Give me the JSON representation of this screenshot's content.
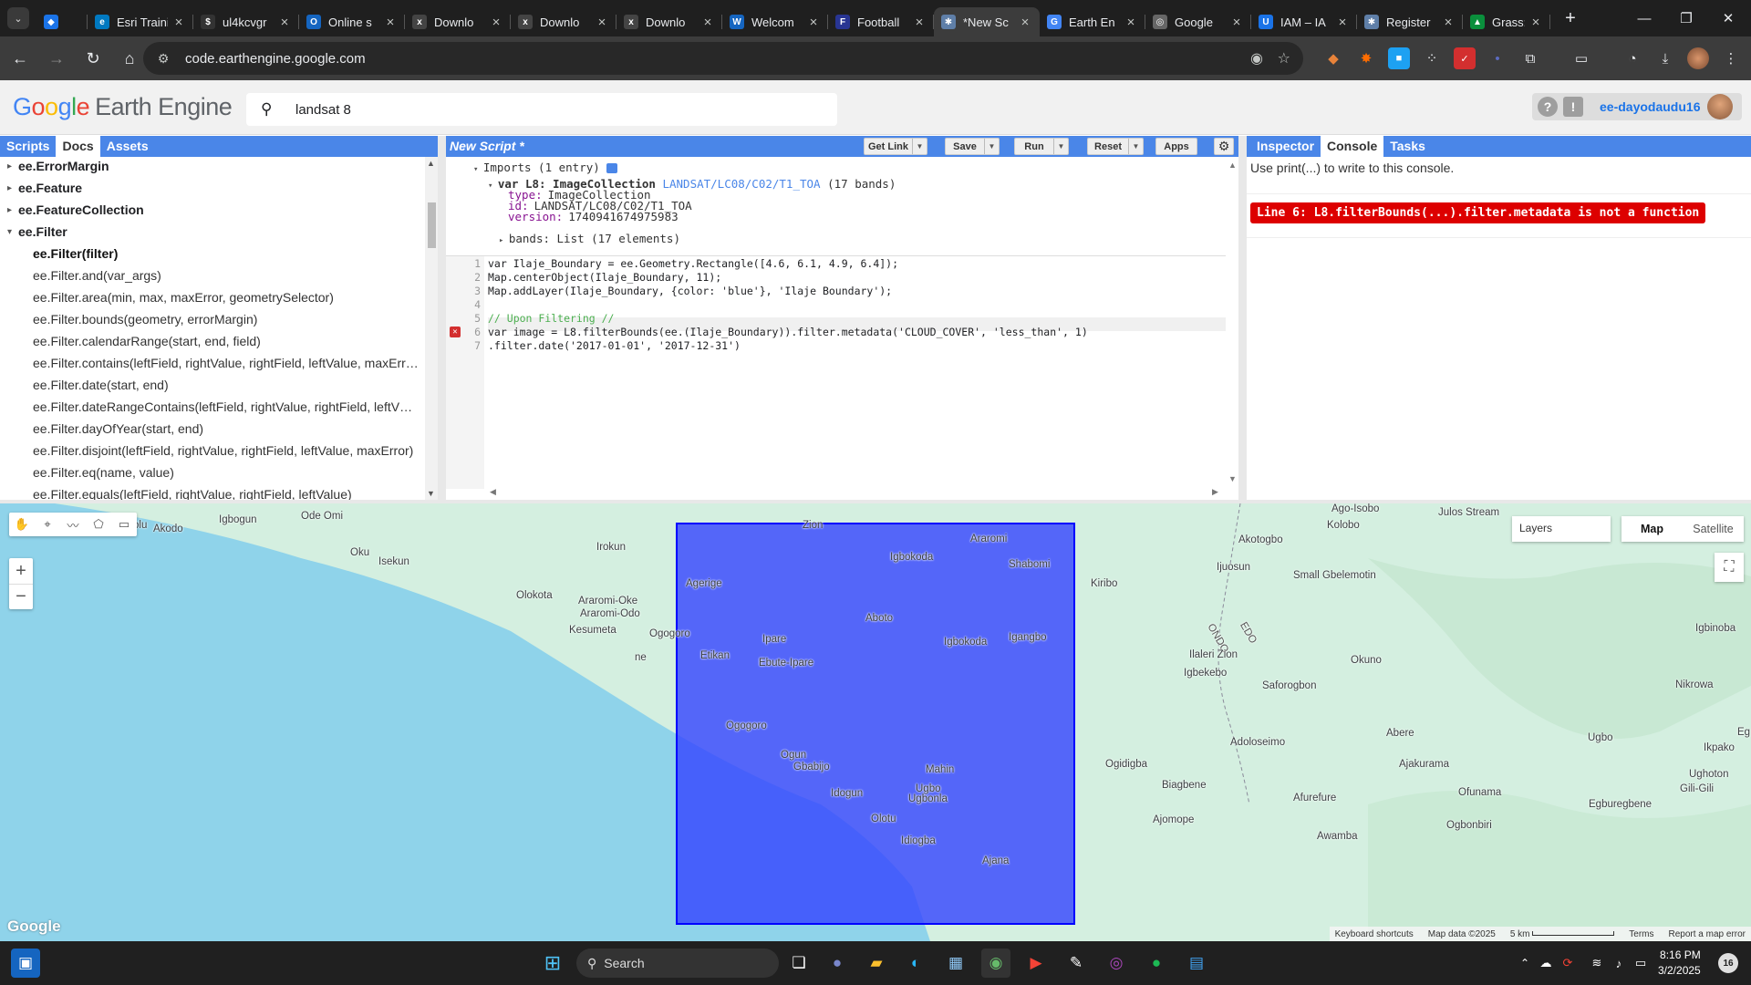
{
  "browser": {
    "tabs": [
      {
        "title": "",
        "fav_color": "#1a73e8",
        "fav": "◆"
      },
      {
        "title": "Esri Training",
        "fav_color": "#0079c1",
        "fav": "e"
      },
      {
        "title": "ul4kcvgr",
        "fav_color": "#333333",
        "fav": "$"
      },
      {
        "title": "Online s",
        "fav_color": "#1565c0",
        "fav": "O"
      },
      {
        "title": "Downlo",
        "fav_color": "#444444",
        "fav": "x"
      },
      {
        "title": "Downlo",
        "fav_color": "#444444",
        "fav": "x"
      },
      {
        "title": "Downlo",
        "fav_color": "#444444",
        "fav": "x"
      },
      {
        "title": "Welcom",
        "fav_color": "#1565c0",
        "fav": "W"
      },
      {
        "title": "Football",
        "fav_color": "#283593",
        "fav": "F"
      },
      {
        "title": "*New Sc",
        "fav_color": "#5f7fa8",
        "fav": "✱",
        "active": true
      },
      {
        "title": "Earth En",
        "fav_color": "#4285f4",
        "fav": "G"
      },
      {
        "title": "Google",
        "fav_color": "#666666",
        "fav": "◎"
      },
      {
        "title": "IAM – IA",
        "fav_color": "#1a73e8",
        "fav": "U"
      },
      {
        "title": "Register",
        "fav_color": "#5f7fa8",
        "fav": "✱"
      },
      {
        "title": "Grass: Tr",
        "fav_color": "#0a8f3c",
        "fav": "▲"
      }
    ],
    "url": "code.earthengine.google.com"
  },
  "ee": {
    "logo": {
      "g1": "G",
      "g2": "o",
      "g3": "o",
      "g4": "g",
      "g5": "l",
      "g6": "e",
      "product": "Earth Engine"
    },
    "search_value": "landsat 8",
    "username": "ee-dayodaudu16",
    "help": "?",
    "feedback": "!"
  },
  "left_tabs": [
    "Scripts",
    "Docs",
    "Assets"
  ],
  "docs": [
    {
      "text": "ee.ErrorMargin",
      "kind": "top",
      "arrow": "▸"
    },
    {
      "text": "ee.Feature",
      "kind": "top",
      "arrow": "▸"
    },
    {
      "text": "ee.FeatureCollection",
      "kind": "top",
      "arrow": "▸"
    },
    {
      "text": "ee.Filter",
      "kind": "top",
      "arrow": "▾"
    },
    {
      "text": "ee.Filter(filter)",
      "kind": "sub",
      "bold": true
    },
    {
      "text": "ee.Filter.and(var_args)",
      "kind": "sub"
    },
    {
      "text": "ee.Filter.area(min, max, maxError, geometrySelector)",
      "kind": "sub"
    },
    {
      "text": "ee.Filter.bounds(geometry, errorMargin)",
      "kind": "sub"
    },
    {
      "text": "ee.Filter.calendarRange(start, end, field)",
      "kind": "sub"
    },
    {
      "text": "ee.Filter.contains(leftField, rightValue, rightField, leftValue, maxErr…",
      "kind": "sub"
    },
    {
      "text": "ee.Filter.date(start, end)",
      "kind": "sub"
    },
    {
      "text": "ee.Filter.dateRangeContains(leftField, rightValue, rightField, leftV…",
      "kind": "sub"
    },
    {
      "text": "ee.Filter.dayOfYear(start, end)",
      "kind": "sub"
    },
    {
      "text": "ee.Filter.disjoint(leftField, rightValue, rightField, leftValue, maxError)",
      "kind": "sub"
    },
    {
      "text": "ee.Filter.eq(name, value)",
      "kind": "sub"
    },
    {
      "text": "ee.Filter.equals(leftField, rightValue, rightField, leftValue)",
      "kind": "sub"
    }
  ],
  "editor": {
    "title": "New Script *",
    "buttons": {
      "get_link": "Get Link",
      "save": "Save",
      "run": "Run",
      "reset": "Reset",
      "apps": "Apps"
    },
    "imports_header": "Imports (1 entry)",
    "import_var": "var L8: ImageCollection",
    "import_link": "LANDSAT/LC08/C02/T1_TOA",
    "import_bands_count": "(17 bands)",
    "import_fields": [
      {
        "k": "type:",
        "v": "ImageCollection"
      },
      {
        "k": "id:",
        "v": "LANDSAT/LC08/C02/T1_TOA"
      },
      {
        "k": "version:",
        "v": "1740941674975983"
      }
    ],
    "import_bands": "bands: List (17 elements)",
    "code_lines": [
      "var Ilaje_Boundary = ee.Geometry.Rectangle([4.6, 6.1, 4.9, 6.4]);",
      "Map.centerObject(Ilaje_Boundary, 11);",
      "Map.addLayer(Ilaje_Boundary, {color: 'blue'}, 'Ilaje Boundary');",
      "",
      "// Upon Filtering //",
      "var image = L8.filterBounds(ee.(Ilaje_Boundary)).filter.metadata('CLOUD_COVER', 'less_than', 1)",
      ".filter.date('2017-01-01', '2017-12-31')"
    ]
  },
  "right_tabs": [
    "Inspector",
    "Console",
    "Tasks"
  ],
  "console": {
    "hint": "Use print(...) to write to this console.",
    "error": "Line 6: L8.filterBounds(...).filter.metadata is not a function"
  },
  "map": {
    "layers_label": "Layers",
    "map_type": [
      "Map",
      "Satellite"
    ],
    "zoom_in": "+",
    "zoom_out": "−",
    "google": "Google",
    "attribution": [
      "Keyboard shortcuts",
      "Map data ©2025",
      "5 km",
      "Terms",
      "Report a map error"
    ],
    "rect_color": "#3344ff",
    "places": [
      {
        "n": "Igbogun"
      },
      {
        "n": "Ode Omi"
      },
      {
        "n": "Akodo"
      },
      {
        "n": "olu"
      },
      {
        "n": "Oku"
      },
      {
        "n": "Isekun"
      },
      {
        "n": "Irokun"
      },
      {
        "n": "Olokota"
      },
      {
        "n": "Araromi-Oke"
      },
      {
        "n": "Araromi-Odo"
      },
      {
        "n": "Kesumeta"
      },
      {
        "n": "Ogogoro"
      },
      {
        "n": "ne"
      },
      {
        "n": "Zion"
      },
      {
        "n": "Araromi"
      },
      {
        "n": "Igbokoda"
      },
      {
        "n": "Shabomi"
      },
      {
        "n": "Agerige"
      },
      {
        "n": "Aboto"
      },
      {
        "n": "Ipare"
      },
      {
        "n": "Igbokoda"
      },
      {
        "n": "Igangbo"
      },
      {
        "n": "Etikan"
      },
      {
        "n": "Ebute-Ipare"
      },
      {
        "n": "Ogogoro"
      },
      {
        "n": "Ogun"
      },
      {
        "n": "Gbabijo"
      },
      {
        "n": "Mahin"
      },
      {
        "n": "Idogun"
      },
      {
        "n": "Ugbo"
      },
      {
        "n": "Ugbonla"
      },
      {
        "n": "Olotu"
      },
      {
        "n": "Idiogba"
      },
      {
        "n": "Ajana"
      },
      {
        "n": "Kiribo"
      },
      {
        "n": "Ago-Isobo"
      },
      {
        "n": "Kolobo"
      },
      {
        "n": "Julos Stream"
      },
      {
        "n": "Akotogbo"
      },
      {
        "n": "Ijuosun"
      },
      {
        "n": "Small Gbelemotin"
      },
      {
        "n": "ONDO"
      },
      {
        "n": "EDO"
      },
      {
        "n": "Ilaleri Zion"
      },
      {
        "n": "Igbekebo"
      },
      {
        "n": "Saforogbon"
      },
      {
        "n": "Okuno"
      },
      {
        "n": "Igbinoba"
      },
      {
        "n": "Nikrowa"
      },
      {
        "n": "Adoloseimo"
      },
      {
        "n": "Abere"
      },
      {
        "n": "Ugbo"
      },
      {
        "n": "Ikpako"
      },
      {
        "n": "Eg"
      },
      {
        "n": "Ogidigba"
      },
      {
        "n": "Ajakurama"
      },
      {
        "n": "Ughoton"
      },
      {
        "n": "Gili-Gili"
      },
      {
        "n": "Biagbene"
      },
      {
        "n": "Ofunama"
      },
      {
        "n": "Afurefure"
      },
      {
        "n": "Egburegbene"
      },
      {
        "n": "Ajomope"
      },
      {
        "n": "Ogbonbiri"
      },
      {
        "n": "Awamba"
      }
    ]
  },
  "taskbar": {
    "search": "Search",
    "time": "8:16 PM",
    "date": "3/2/2025",
    "badge": "16"
  }
}
